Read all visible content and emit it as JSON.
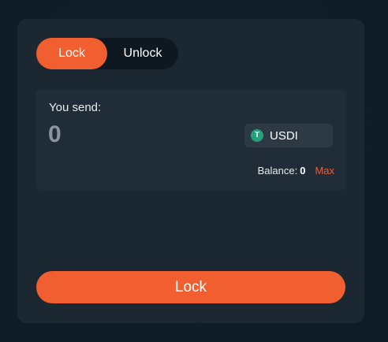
{
  "tabs": [
    {
      "label": "Lock",
      "active": true
    },
    {
      "label": "Unlock",
      "active": false
    }
  ],
  "send": {
    "label": "You send:",
    "amount_placeholder": "0",
    "token": {
      "name": "USDI",
      "icon": "tether-icon",
      "icon_glyph": "T",
      "icon_color": "#26a17b"
    },
    "balance_label": "Balance:",
    "balance_value": "0",
    "max_label": "Max"
  },
  "submit": {
    "label": "Lock"
  },
  "colors": {
    "accent": "#f15f31",
    "card": "#1b2731",
    "background": "#0f1c27"
  }
}
